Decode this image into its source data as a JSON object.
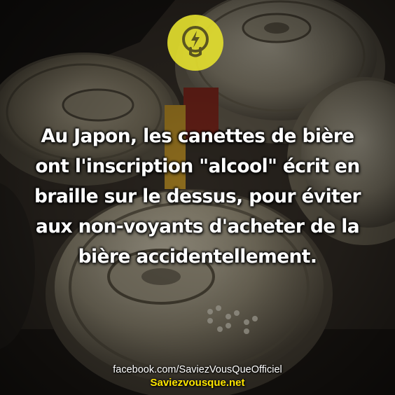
{
  "fact": {
    "lines": [
      "Au Japon, les canettes de bière",
      "ont l'inscription \"alcool\" écrit en",
      "braille sur le dessus, pour éviter",
      "aux non-voyants d'acheter de la",
      "bière accidentellement."
    ]
  },
  "footer": {
    "facebook": "facebook.com/SaviezVousQueOfficiel",
    "site": "Saviezvousque.net"
  },
  "logo": {
    "icon": "lightbulb-bolt-icon"
  },
  "colors": {
    "text": "#ffffff",
    "site_link": "#ffe600",
    "logo_circle": "#e2dd2f"
  },
  "photo": {
    "subject": "beer cans with braille dots on lids"
  }
}
